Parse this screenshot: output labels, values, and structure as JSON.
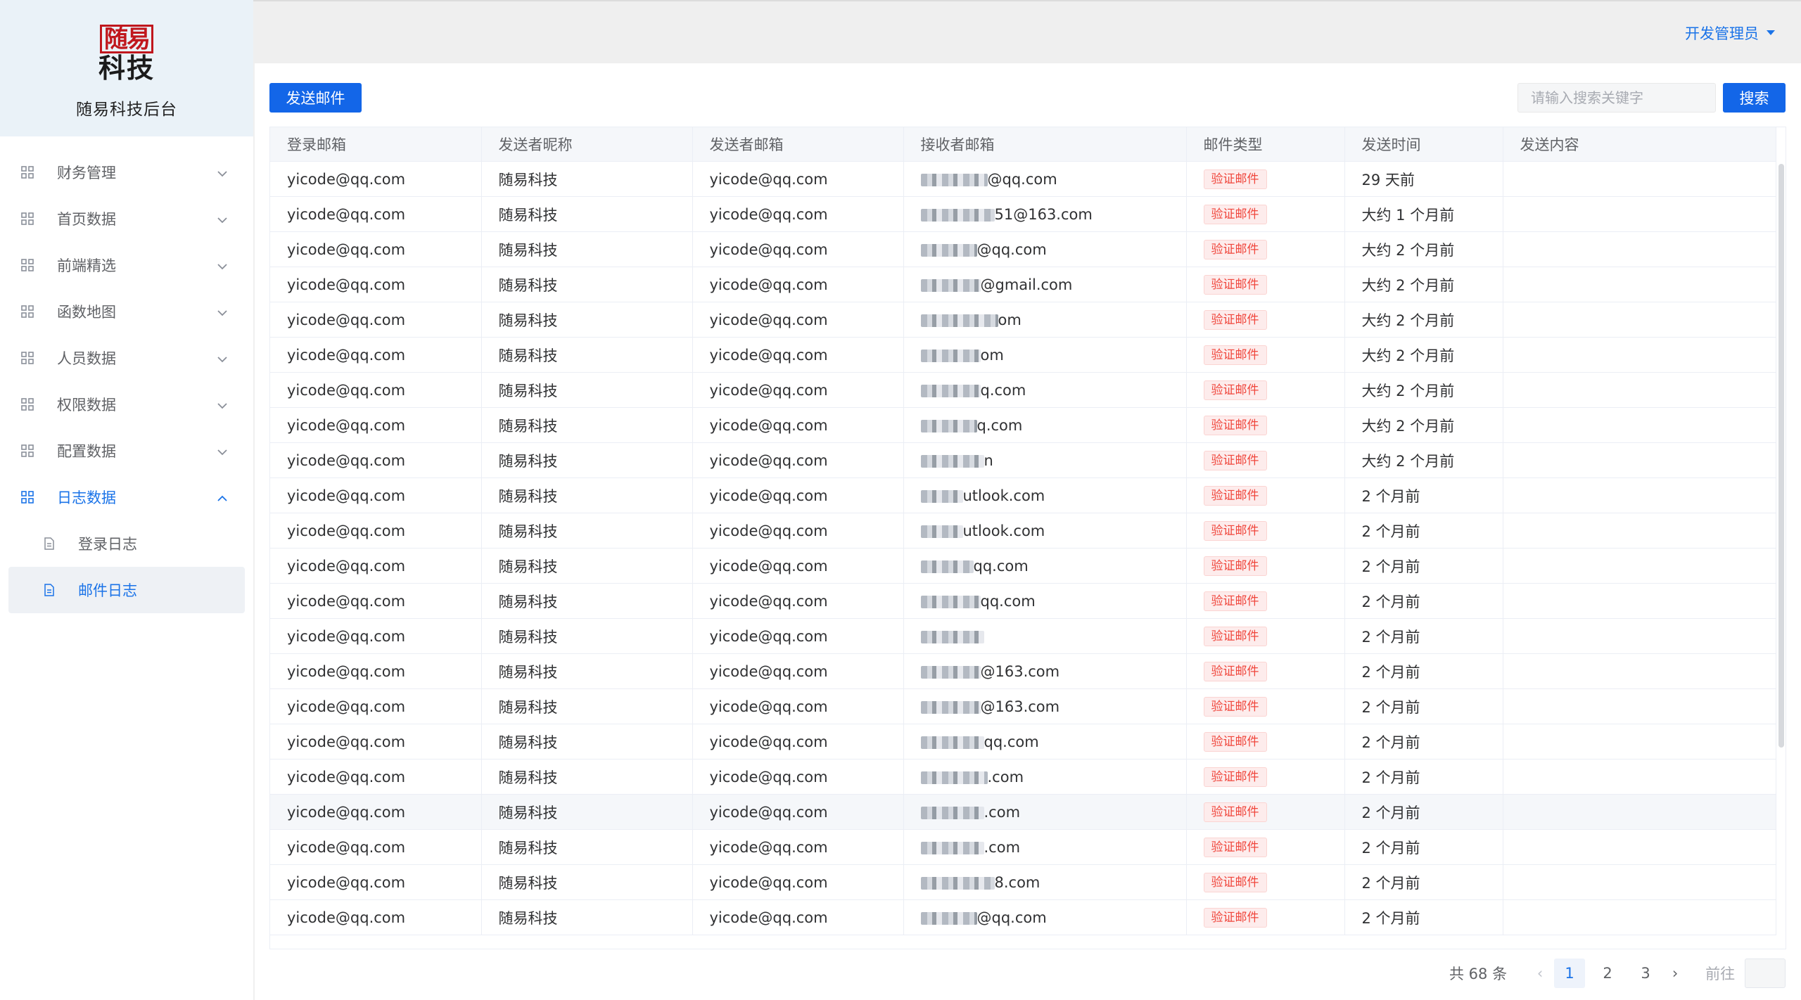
{
  "brand": {
    "logo_line1": "随易",
    "logo_line2": "科技",
    "title": "随易科技后台"
  },
  "sidebar": {
    "items": [
      {
        "label": "财务管理",
        "open": false
      },
      {
        "label": "首页数据",
        "open": false
      },
      {
        "label": "前端精选",
        "open": false
      },
      {
        "label": "函数地图",
        "open": false
      },
      {
        "label": "人员数据",
        "open": false
      },
      {
        "label": "权限数据",
        "open": false
      },
      {
        "label": "配置数据",
        "open": false
      },
      {
        "label": "日志数据",
        "open": true
      }
    ],
    "subitems": [
      {
        "label": "登录日志",
        "active": false
      },
      {
        "label": "邮件日志",
        "active": true
      }
    ]
  },
  "header": {
    "user": "开发管理员"
  },
  "toolbar": {
    "send_label": "发送邮件",
    "search_placeholder": "请输入搜索关键字",
    "search_label": "搜索"
  },
  "table": {
    "columns": [
      "登录邮箱",
      "发送者昵称",
      "发送者邮箱",
      "接收者邮箱",
      "邮件类型",
      "发送时间",
      "发送内容"
    ],
    "rows": [
      {
        "login": "yicode@qq.com",
        "nick": "随易科技",
        "sender": "yicode@qq.com",
        "receiver": "@qq.com",
        "type": "验证邮件",
        "time": "29 天前",
        "content": ""
      },
      {
        "login": "yicode@qq.com",
        "nick": "随易科技",
        "sender": "yicode@qq.com",
        "receiver": "51@163.com",
        "type": "验证邮件",
        "time": "大约 1 个月前",
        "content": ""
      },
      {
        "login": "yicode@qq.com",
        "nick": "随易科技",
        "sender": "yicode@qq.com",
        "receiver": "@qq.com",
        "type": "验证邮件",
        "time": "大约 2 个月前",
        "content": ""
      },
      {
        "login": "yicode@qq.com",
        "nick": "随易科技",
        "sender": "yicode@qq.com",
        "receiver": "@gmail.com",
        "type": "验证邮件",
        "time": "大约 2 个月前",
        "content": ""
      },
      {
        "login": "yicode@qq.com",
        "nick": "随易科技",
        "sender": "yicode@qq.com",
        "receiver": "om",
        "type": "验证邮件",
        "time": "大约 2 个月前",
        "content": ""
      },
      {
        "login": "yicode@qq.com",
        "nick": "随易科技",
        "sender": "yicode@qq.com",
        "receiver": "om",
        "type": "验证邮件",
        "time": "大约 2 个月前",
        "content": ""
      },
      {
        "login": "yicode@qq.com",
        "nick": "随易科技",
        "sender": "yicode@qq.com",
        "receiver": "q.com",
        "type": "验证邮件",
        "time": "大约 2 个月前",
        "content": ""
      },
      {
        "login": "yicode@qq.com",
        "nick": "随易科技",
        "sender": "yicode@qq.com",
        "receiver": "q.com",
        "type": "验证邮件",
        "time": "大约 2 个月前",
        "content": ""
      },
      {
        "login": "yicode@qq.com",
        "nick": "随易科技",
        "sender": "yicode@qq.com",
        "receiver": "n",
        "type": "验证邮件",
        "time": "大约 2 个月前",
        "content": ""
      },
      {
        "login": "yicode@qq.com",
        "nick": "随易科技",
        "sender": "yicode@qq.com",
        "receiver": "utlook.com",
        "type": "验证邮件",
        "time": "2 个月前",
        "content": ""
      },
      {
        "login": "yicode@qq.com",
        "nick": "随易科技",
        "sender": "yicode@qq.com",
        "receiver": "utlook.com",
        "type": "验证邮件",
        "time": "2 个月前",
        "content": ""
      },
      {
        "login": "yicode@qq.com",
        "nick": "随易科技",
        "sender": "yicode@qq.com",
        "receiver": "qq.com",
        "type": "验证邮件",
        "time": "2 个月前",
        "content": ""
      },
      {
        "login": "yicode@qq.com",
        "nick": "随易科技",
        "sender": "yicode@qq.com",
        "receiver": "qq.com",
        "type": "验证邮件",
        "time": "2 个月前",
        "content": ""
      },
      {
        "login": "yicode@qq.com",
        "nick": "随易科技",
        "sender": "yicode@qq.com",
        "receiver": "",
        "type": "验证邮件",
        "time": "2 个月前",
        "content": ""
      },
      {
        "login": "yicode@qq.com",
        "nick": "随易科技",
        "sender": "yicode@qq.com",
        "receiver": "@163.com",
        "type": "验证邮件",
        "time": "2 个月前",
        "content": ""
      },
      {
        "login": "yicode@qq.com",
        "nick": "随易科技",
        "sender": "yicode@qq.com",
        "receiver": "@163.com",
        "type": "验证邮件",
        "time": "2 个月前",
        "content": ""
      },
      {
        "login": "yicode@qq.com",
        "nick": "随易科技",
        "sender": "yicode@qq.com",
        "receiver": "qq.com",
        "type": "验证邮件",
        "time": "2 个月前",
        "content": ""
      },
      {
        "login": "yicode@qq.com",
        "nick": "随易科技",
        "sender": "yicode@qq.com",
        "receiver": ".com",
        "type": "验证邮件",
        "time": "2 个月前",
        "content": ""
      },
      {
        "login": "yicode@qq.com",
        "nick": "随易科技",
        "sender": "yicode@qq.com",
        "receiver": ".com",
        "type": "验证邮件",
        "time": "2 个月前",
        "content": ""
      },
      {
        "login": "yicode@qq.com",
        "nick": "随易科技",
        "sender": "yicode@qq.com",
        "receiver": ".com",
        "type": "验证邮件",
        "time": "2 个月前",
        "content": ""
      },
      {
        "login": "yicode@qq.com",
        "nick": "随易科技",
        "sender": "yicode@qq.com",
        "receiver": "8.com",
        "type": "验证邮件",
        "time": "2 个月前",
        "content": ""
      },
      {
        "login": "yicode@qq.com",
        "nick": "随易科技",
        "sender": "yicode@qq.com",
        "receiver": "@qq.com",
        "type": "验证邮件",
        "time": "2 个月前",
        "content": ""
      }
    ]
  },
  "pagination": {
    "total": "共 68 条",
    "pages": [
      "1",
      "2",
      "3"
    ],
    "current": "1",
    "goto": "前往"
  },
  "colors": {
    "accent": "#1a73e8",
    "primary_button": "#1366e8",
    "tag_text": "#f0463c",
    "tag_bg": "#fdecec",
    "logo_red": "#c0171d"
  },
  "icons": {
    "menu": "grid-icon",
    "submenu": "document-icon",
    "collapse": "chevron-down-icon",
    "expand": "chevron-up-icon",
    "user_menu": "caret-down-icon"
  }
}
